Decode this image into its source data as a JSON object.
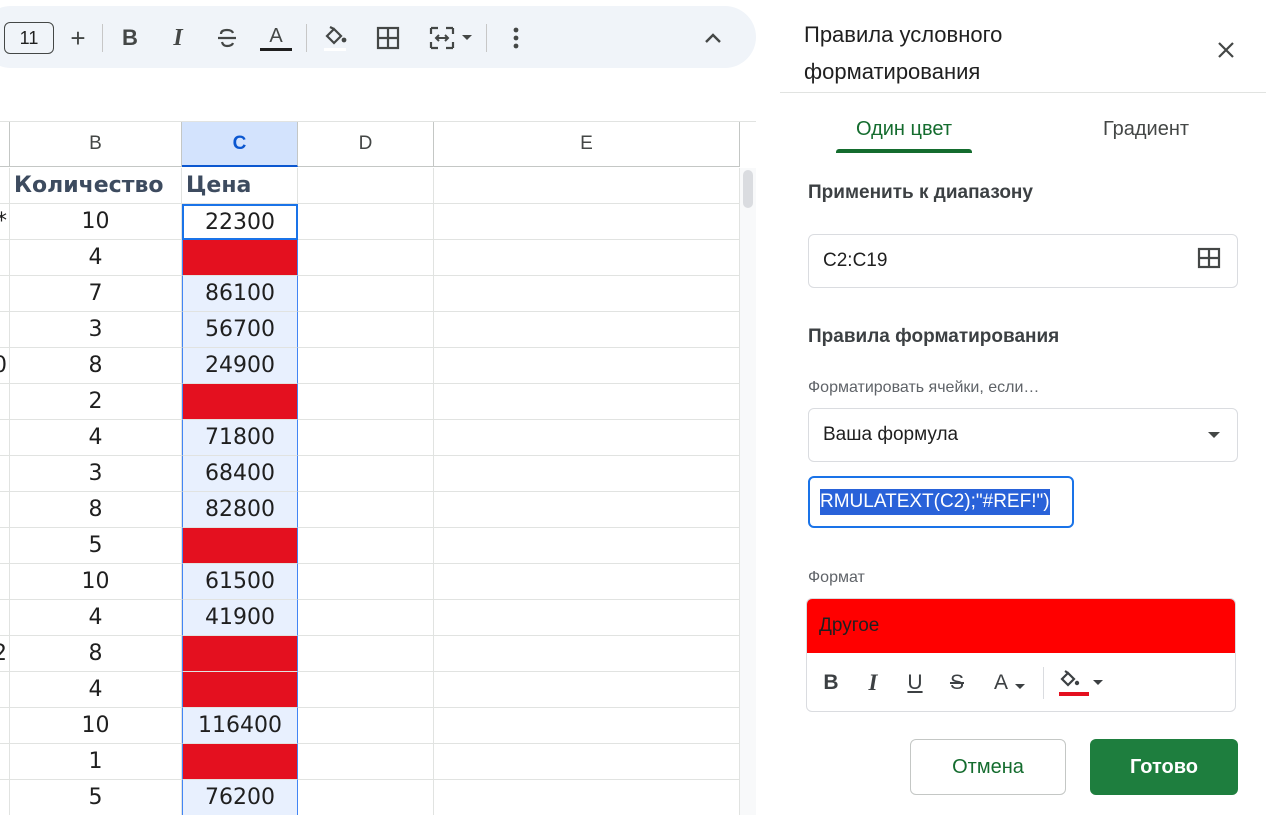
{
  "toolbar": {
    "font_size": "11",
    "increase_font": "+",
    "bold": "B",
    "italic": "I",
    "text_color": "A"
  },
  "columns": [
    "B",
    "C",
    "D",
    "E"
  ],
  "grid": {
    "header_row": {
      "a": "",
      "b": "Количество",
      "c": "Цена"
    },
    "rows": [
      {
        "a": "*",
        "b": "10",
        "c": "22300",
        "red": false
      },
      {
        "a": "",
        "b": "4",
        "c": "",
        "red": true
      },
      {
        "a": "",
        "b": "7",
        "c": "86100",
        "red": false
      },
      {
        "a": "",
        "b": "3",
        "c": "56700",
        "red": false
      },
      {
        "a": "0",
        "b": "8",
        "c": "24900",
        "red": false
      },
      {
        "a": "",
        "b": "2",
        "c": "",
        "red": true
      },
      {
        "a": "",
        "b": "4",
        "c": "71800",
        "red": false
      },
      {
        "a": "",
        "b": "3",
        "c": "68400",
        "red": false
      },
      {
        "a": "",
        "b": "8",
        "c": "82800",
        "red": false
      },
      {
        "a": "",
        "b": "5",
        "c": "",
        "red": true
      },
      {
        "a": "",
        "b": "10",
        "c": "61500",
        "red": false
      },
      {
        "a": "",
        "b": "4",
        "c": "41900",
        "red": false
      },
      {
        "a": "2",
        "b": "8",
        "c": "",
        "red": true
      },
      {
        "a": "",
        "b": "4",
        "c": "",
        "red": true
      },
      {
        "a": "",
        "b": "10",
        "c": "116400",
        "red": false
      },
      {
        "a": "",
        "b": "1",
        "c": "",
        "red": true
      },
      {
        "a": "",
        "b": "5",
        "c": "76200",
        "red": false
      }
    ]
  },
  "panel": {
    "title": "Правила условного форматирования",
    "tabs": [
      "Один цвет",
      "Градиент"
    ],
    "apply_range_label": "Применить к диапазону",
    "range_value": "C2:C19",
    "rules_label": "Правила форматирования",
    "condition_label": "Форматировать ячейки, если…",
    "condition_value": "Ваша формула",
    "formula_value": "RMULATEXT(C2);\"#REF!\")",
    "format_label": "Формат",
    "format_preview": "Другое",
    "format_tools": {
      "bold": "B",
      "italic": "I",
      "underline": "U",
      "strike": "S",
      "text_color": "A"
    },
    "cancel": "Отмена",
    "done": "Готово"
  },
  "colors": {
    "rule_red": "#e4101f",
    "preview_red": "#ff0000",
    "accent_green": "#146c2e",
    "selection_blue": "#1a73e8"
  }
}
